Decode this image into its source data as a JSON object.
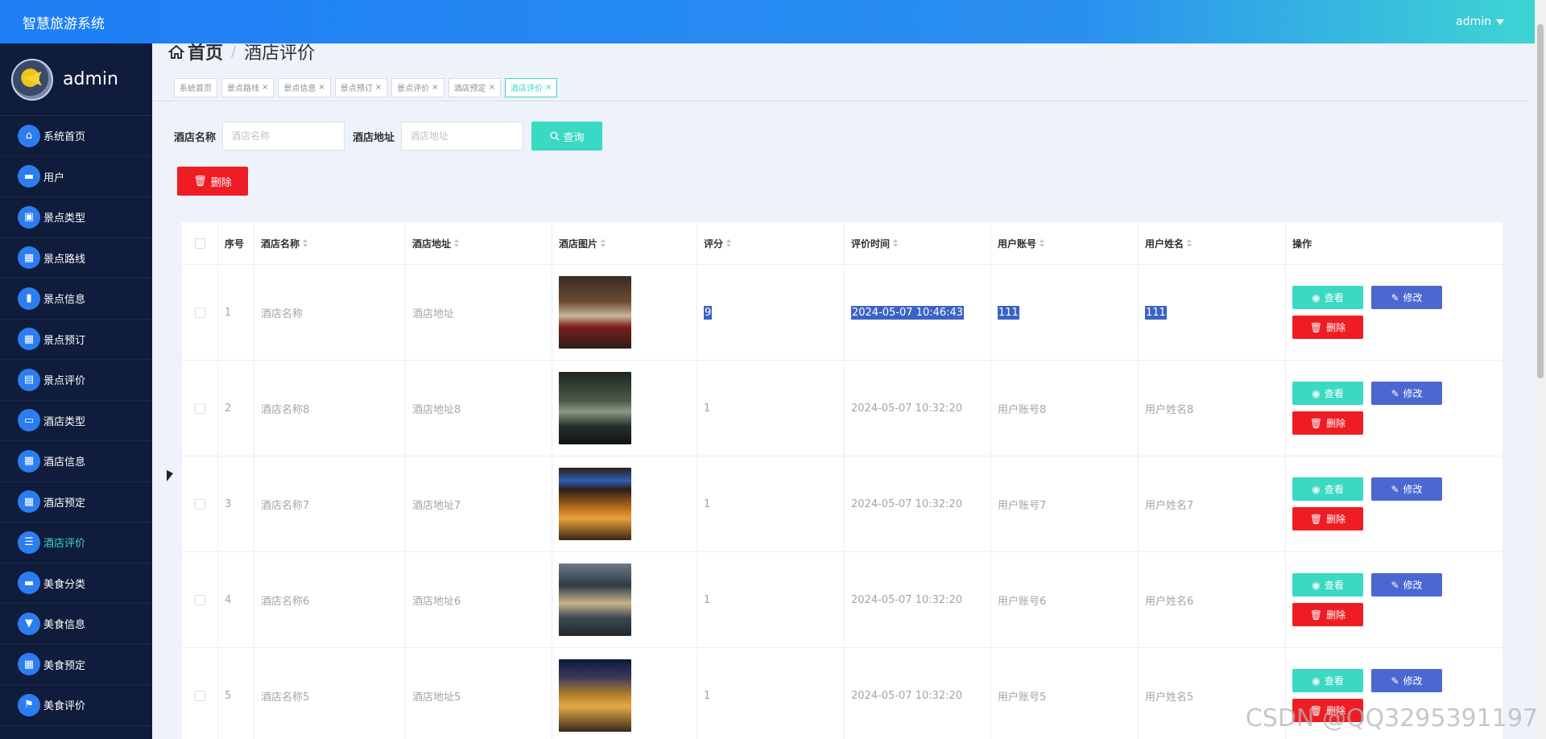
{
  "header": {
    "app_title": "智慧旅游系统",
    "user_label": "admin"
  },
  "sidebar": {
    "profile_name": "admin",
    "items": [
      {
        "label": "系统首页",
        "icon": "home-icon",
        "glyph": "⌂"
      },
      {
        "label": "用户",
        "icon": "chat-icon",
        "glyph": "▬"
      },
      {
        "label": "景点类型",
        "icon": "briefcase-icon",
        "glyph": "▣"
      },
      {
        "label": "景点路线",
        "icon": "grid-icon",
        "glyph": "▦"
      },
      {
        "label": "景点信息",
        "icon": "bar-chart-icon",
        "glyph": "▮"
      },
      {
        "label": "景点预订",
        "icon": "grid-icon",
        "glyph": "▦"
      },
      {
        "label": "景点评价",
        "icon": "clipboard-icon",
        "glyph": "▤"
      },
      {
        "label": "酒店类型",
        "icon": "ticket-icon",
        "glyph": "▭"
      },
      {
        "label": "酒店信息",
        "icon": "grid-icon",
        "glyph": "▦"
      },
      {
        "label": "酒店预定",
        "icon": "grid-icon",
        "glyph": "▦"
      },
      {
        "label": "酒店评价",
        "icon": "sliders-icon",
        "glyph": "☰"
      },
      {
        "label": "美食分类",
        "icon": "monitor-icon",
        "glyph": "▬"
      },
      {
        "label": "美食信息",
        "icon": "signpost-icon",
        "glyph": "▼"
      },
      {
        "label": "美食预定",
        "icon": "grid-icon",
        "glyph": "▦"
      },
      {
        "label": "美食评价",
        "icon": "flag-icon",
        "glyph": "⚑"
      }
    ]
  },
  "breadcrumb": {
    "home": "首页",
    "separator": "/",
    "current": "酒店评价"
  },
  "tags": [
    {
      "label": "系统首页",
      "closable": false,
      "active": false
    },
    {
      "label": "景点路线",
      "closable": true,
      "active": false
    },
    {
      "label": "景点信息",
      "closable": true,
      "active": false
    },
    {
      "label": "景点预订",
      "closable": true,
      "active": false
    },
    {
      "label": "景点评价",
      "closable": true,
      "active": false
    },
    {
      "label": "酒店预定",
      "closable": true,
      "active": false
    },
    {
      "label": "酒店评价",
      "closable": true,
      "active": true
    }
  ],
  "search": {
    "name_label": "酒店名称",
    "name_placeholder": "酒店名称",
    "addr_label": "酒店地址",
    "addr_placeholder": "酒店地址",
    "button": "查询"
  },
  "toolbar": {
    "delete_label": "删除"
  },
  "table": {
    "columns": [
      "序号",
      "酒店名称",
      "酒店地址",
      "酒店图片",
      "评分",
      "评价时间",
      "用户账号",
      "用户姓名",
      "操作"
    ],
    "actions": {
      "view": "查看",
      "edit": "修改",
      "delete": "删除"
    },
    "rows": [
      {
        "idx": "1",
        "name": "酒店名称",
        "addr": "酒店地址",
        "score": "9",
        "time": "2024-05-07 10:46:43",
        "account": "111",
        "user": "111",
        "highlighted": true,
        "image": "hotel-room-photo"
      },
      {
        "idx": "2",
        "name": "酒店名称8",
        "addr": "酒店地址8",
        "score": "1",
        "time": "2024-05-07 10:32:20",
        "account": "用户账号8",
        "user": "用户姓名8",
        "highlighted": false,
        "image": "hotel-exterior-night-photo"
      },
      {
        "idx": "3",
        "name": "酒店名称7",
        "addr": "酒店地址7",
        "score": "1",
        "time": "2024-05-07 10:32:20",
        "account": "用户账号7",
        "user": "用户姓名7",
        "highlighted": false,
        "image": "seven-days-hotel-photo"
      },
      {
        "idx": "4",
        "name": "酒店名称6",
        "addr": "酒店地址6",
        "score": "1",
        "time": "2024-05-07 10:32:20",
        "account": "用户账号6",
        "user": "用户姓名6",
        "highlighted": false,
        "image": "hotel-facade-photo"
      },
      {
        "idx": "5",
        "name": "酒店名称5",
        "addr": "酒店地址5",
        "score": "1",
        "time": "2024-05-07 10:32:20",
        "account": "用户账号5",
        "user": "用户姓名5",
        "highlighted": false,
        "image": "hotel-evening-photo"
      }
    ]
  },
  "watermark": "CSDN @QQ3295391197",
  "colors": {
    "accent": "#3ad9c4",
    "primary": "#2b7df0",
    "danger": "#ee1d24",
    "edit": "#4b68d2",
    "sidebar_bg": "#0f1c3b"
  }
}
